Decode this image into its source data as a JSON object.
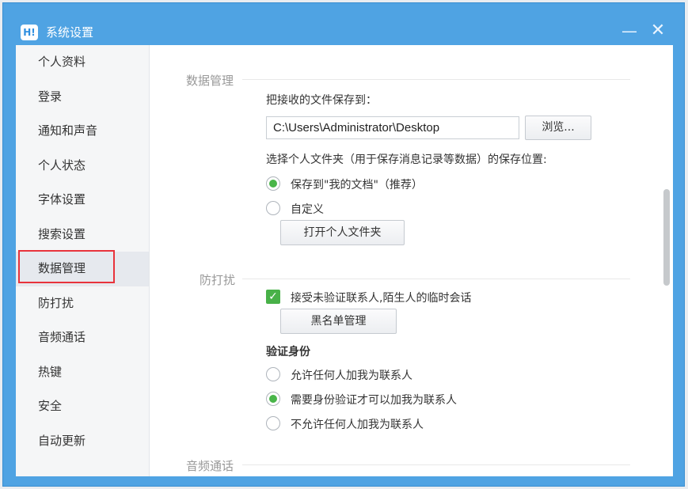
{
  "window": {
    "title": "系统设置",
    "logo_text": "H!",
    "minimize_symbol": "—",
    "close_symbol": "✕"
  },
  "sidebar": {
    "items": [
      {
        "label": "个人资料"
      },
      {
        "label": "登录"
      },
      {
        "label": "通知和声音"
      },
      {
        "label": "个人状态"
      },
      {
        "label": "字体设置"
      },
      {
        "label": "搜索设置"
      },
      {
        "label": "数据管理",
        "active": true
      },
      {
        "label": "防打扰"
      },
      {
        "label": "音频通话"
      },
      {
        "label": "热键"
      },
      {
        "label": "安全"
      },
      {
        "label": "自动更新"
      }
    ]
  },
  "data_management": {
    "section_title": "数据管理",
    "save_to_label": "把接收的文件保存到：",
    "save_path": "C:\\Users\\Administrator\\Desktop",
    "browse_button": "浏览...",
    "folder_location_label": "选择个人文件夹（用于保存消息记录等数据）的保存位置:",
    "option_my_documents": "保存到\"我的文档\"（推荐）",
    "option_custom": "自定义",
    "selected_option": "my_documents",
    "open_folder_button": "打开个人文件夹"
  },
  "do_not_disturb": {
    "section_title": "防打扰",
    "accept_unverified_label": "接受未验证联系人,陌生人的临时会话",
    "accept_unverified_checked": true,
    "blacklist_button": "黑名单管理",
    "verify_identity_title": "验证身份",
    "option_allow_anyone": "允许任何人加我为联系人",
    "option_require_verification": "需要身份验证才可以加我为联系人",
    "option_disallow_anyone": "不允许任何人加我为联系人",
    "selected_option": "require_verification"
  },
  "audio_call": {
    "section_title": "音频通话"
  },
  "colors": {
    "titlebar": "#4fa3e3",
    "accent_green": "#48b148",
    "highlight_red": "#e8333b"
  }
}
